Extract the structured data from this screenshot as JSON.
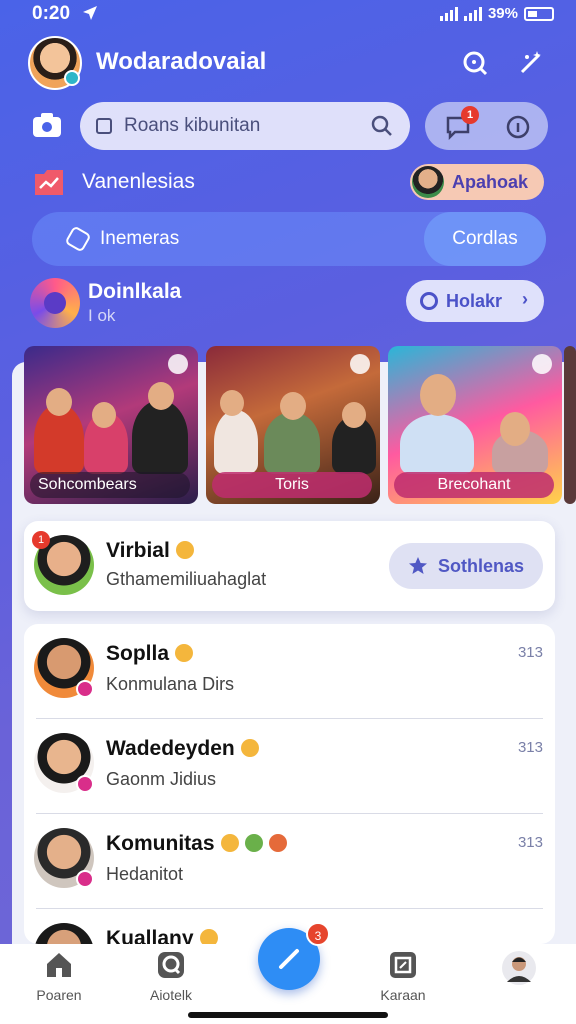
{
  "status_bar": {
    "time": "0:20",
    "battery_percent": "39%"
  },
  "header": {
    "app_title": "Wodaradovaial"
  },
  "search": {
    "placeholder": "Roans kibunitan",
    "notification_count": "1"
  },
  "section": {
    "label": "Vanenlesias",
    "chip_label": "Apahoak"
  },
  "tabs": {
    "left_label": "Inemeras",
    "right_label": "Cordlas"
  },
  "community": {
    "title": "Doinlkala",
    "subtitle": "I ok",
    "button_label": "Holakr"
  },
  "stories": [
    {
      "label": "Sohcombears"
    },
    {
      "label": "Toris"
    },
    {
      "label": "Brecohant"
    }
  ],
  "featured_chat": {
    "badge": "1",
    "name": "Virbial",
    "message": "Gthamemiliuahaglat",
    "button_label": "Sothlenas"
  },
  "chats": [
    {
      "name": "Soplla",
      "message": "Konmulana Dirs",
      "time": "313"
    },
    {
      "name": "Wadedeyden",
      "message": "Gaonm Jidius",
      "time": "313"
    },
    {
      "name": "Komunitas",
      "message": "Hedanitot",
      "time": "313"
    },
    {
      "name": "Kuallany",
      "message": "",
      "time": ""
    }
  ],
  "bottom_nav": {
    "home": "Poaren",
    "search": "Aiotelk",
    "fab_badge": "3",
    "files": "Karaan",
    "profile": ""
  },
  "colors": {
    "accent": "#2e8df5",
    "badge_red": "#e63a2d",
    "chip_bg": "#f6c9b4"
  }
}
